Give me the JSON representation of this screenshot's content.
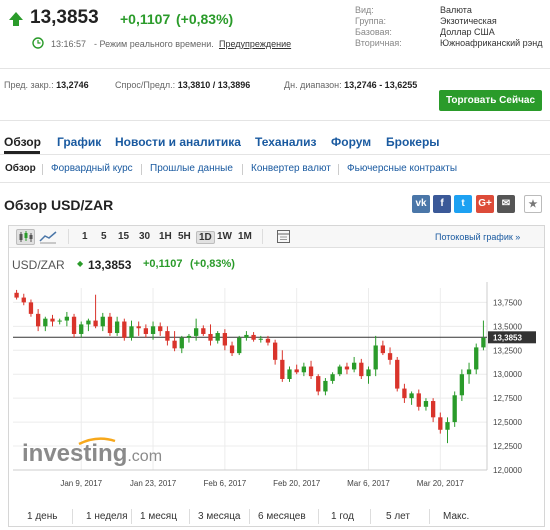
{
  "quote": {
    "price": "13,3853",
    "change": "+0,1107",
    "change_pct": "(+0,83%)",
    "time": "13:16:57",
    "realtime_text": "- Режим реального времени.",
    "warning_link": "Предупреждение",
    "up_color": "#2a9b2a",
    "down_color": "#d9342b"
  },
  "info": {
    "rows": [
      {
        "k": "Вид:",
        "v": "Валюта"
      },
      {
        "k": "Группа:",
        "v": "Экзотическая"
      },
      {
        "k": "Базовая:",
        "v": "Доллар США"
      },
      {
        "k": "Вторичная:",
        "v": "Южноафриканский рэнд"
      }
    ]
  },
  "stats": {
    "prev_close_label": "Пред. закр.:",
    "prev_close": "13,2746",
    "bid_ask_label": "Спрос/Предл.:",
    "bid_ask": "13,3810 / 13,3896",
    "day_range_label": "Дн. диапазон:",
    "day_range": "13,2746 - 13,6255"
  },
  "trade_button": "Торговать Сейчас",
  "nav": {
    "tabs": [
      "Обзор",
      "График",
      "Новости и аналитика",
      "Теханализ",
      "Форум",
      "Брокеры"
    ],
    "sub": [
      "Обзор",
      "Форвардный курс",
      "Прошлые данные",
      "Конвертер валют",
      "Фьючерсные контракты"
    ]
  },
  "section_title": "Обзор USD/ZAR",
  "share_icons": [
    {
      "name": "vk-icon",
      "glyph": "vk",
      "color": "#4a76a8"
    },
    {
      "name": "facebook-icon",
      "glyph": "f",
      "color": "#3b5998"
    },
    {
      "name": "twitter-icon",
      "glyph": "t",
      "color": "#1da1f2"
    },
    {
      "name": "google-plus-icon",
      "glyph": "G+",
      "color": "#dd4b39"
    },
    {
      "name": "email-icon",
      "glyph": "✉",
      "color": "#555555"
    },
    {
      "name": "bookmark-icon",
      "glyph": "★",
      "color": "#777777"
    }
  ],
  "toolbar": {
    "intervals": [
      "1",
      "5",
      "15",
      "30",
      "1H",
      "5H",
      "1D",
      "1W",
      "1M"
    ],
    "active_interval": "1D",
    "stream_link": "Потоковый график »"
  },
  "chart_header": {
    "symbol": "USD/ZAR",
    "arrow": "◆",
    "price": "13,3853",
    "change": "+0,1107",
    "change_pct": "(+0,83%)"
  },
  "logo": {
    "main": "investing",
    "suffix": ".com"
  },
  "ranges": [
    "1 день",
    "1 неделя",
    "1 месяц",
    "3 месяца",
    "6 месяцев",
    "1 год",
    "5 лет",
    "Макс."
  ],
  "chart_data": {
    "type": "candlestick",
    "ylim": [
      12.0,
      13.9
    ],
    "yticks": [
      "13,7500",
      "13,5000",
      "13,2500",
      "13,0000",
      "12,7500",
      "12,5000",
      "12,2500",
      "12,0000"
    ],
    "ytick_values": [
      13.75,
      13.5,
      13.25,
      13.0,
      12.75,
      12.5,
      12.25,
      12.0
    ],
    "xticks": [
      "Jan 9, 2017",
      "Jan 23, 2017",
      "Feb 6, 2017",
      "Feb 20, 2017",
      "Mar 6, 2017",
      "Mar 20, 2017"
    ],
    "xtick_index": [
      9,
      19,
      29,
      39,
      49,
      59
    ],
    "current_price_label": "13,3853",
    "current_price": 13.3853,
    "candles": [
      [
        13.85,
        13.88,
        13.78,
        13.8
      ],
      [
        13.8,
        13.84,
        13.72,
        13.75
      ],
      [
        13.75,
        13.78,
        13.6,
        13.63
      ],
      [
        13.63,
        13.68,
        13.45,
        13.5
      ],
      [
        13.5,
        13.6,
        13.45,
        13.58
      ],
      [
        13.58,
        13.62,
        13.5,
        13.55
      ],
      [
        13.55,
        13.58,
        13.52,
        13.56
      ],
      [
        13.56,
        13.65,
        13.5,
        13.6
      ],
      [
        13.6,
        13.63,
        13.38,
        13.42
      ],
      [
        13.42,
        13.55,
        13.38,
        13.52
      ],
      [
        13.52,
        13.58,
        13.45,
        13.56
      ],
      [
        13.56,
        13.83,
        13.48,
        13.5
      ],
      [
        13.5,
        13.64,
        13.45,
        13.6
      ],
      [
        13.6,
        13.64,
        13.4,
        13.43
      ],
      [
        13.43,
        13.6,
        13.4,
        13.55
      ],
      [
        13.55,
        13.58,
        13.35,
        13.38
      ],
      [
        13.38,
        13.56,
        13.35,
        13.5
      ],
      [
        13.5,
        13.55,
        13.4,
        13.48
      ],
      [
        13.48,
        13.52,
        13.38,
        13.42
      ],
      [
        13.42,
        13.55,
        13.36,
        13.5
      ],
      [
        13.5,
        13.54,
        13.4,
        13.45
      ],
      [
        13.45,
        13.5,
        13.3,
        13.35
      ],
      [
        13.35,
        13.45,
        13.24,
        13.27
      ],
      [
        13.27,
        13.4,
        13.22,
        13.38
      ],
      [
        13.38,
        13.42,
        13.33,
        13.4
      ],
      [
        13.4,
        13.58,
        13.35,
        13.48
      ],
      [
        13.48,
        13.51,
        13.4,
        13.42
      ],
      [
        13.42,
        13.52,
        13.3,
        13.35
      ],
      [
        13.35,
        13.45,
        13.32,
        13.43
      ],
      [
        13.43,
        13.47,
        13.25,
        13.3
      ],
      [
        13.3,
        13.34,
        13.19,
        13.22
      ],
      [
        13.22,
        13.4,
        13.2,
        13.38
      ],
      [
        13.38,
        13.45,
        13.35,
        13.41
      ],
      [
        13.41,
        13.44,
        13.34,
        13.36
      ],
      [
        13.36,
        13.4,
        13.33,
        13.37
      ],
      [
        13.37,
        13.4,
        13.3,
        13.33
      ],
      [
        13.33,
        13.36,
        13.1,
        13.15
      ],
      [
        13.15,
        13.25,
        12.92,
        12.95
      ],
      [
        12.95,
        13.08,
        12.92,
        13.05
      ],
      [
        13.05,
        13.1,
        13.0,
        13.02
      ],
      [
        13.02,
        13.12,
        12.98,
        13.08
      ],
      [
        13.08,
        13.14,
        12.95,
        12.98
      ],
      [
        12.98,
        13.0,
        12.78,
        12.82
      ],
      [
        12.82,
        12.96,
        12.78,
        12.93
      ],
      [
        12.93,
        13.02,
        12.9,
        13.0
      ],
      [
        13.0,
        13.1,
        12.98,
        13.08
      ],
      [
        13.08,
        13.12,
        13.0,
        13.05
      ],
      [
        13.05,
        13.18,
        13.02,
        13.12
      ],
      [
        13.12,
        13.16,
        12.95,
        12.98
      ],
      [
        12.98,
        13.08,
        12.9,
        13.05
      ],
      [
        13.05,
        13.4,
        12.98,
        13.3
      ],
      [
        13.3,
        13.35,
        13.2,
        13.22
      ],
      [
        13.22,
        13.28,
        13.1,
        13.15
      ],
      [
        13.15,
        13.18,
        12.82,
        12.85
      ],
      [
        12.85,
        12.9,
        12.7,
        12.75
      ],
      [
        12.75,
        12.82,
        12.68,
        12.8
      ],
      [
        12.8,
        12.84,
        12.62,
        12.66
      ],
      [
        12.66,
        12.75,
        12.62,
        12.72
      ],
      [
        12.72,
        12.75,
        12.5,
        12.55
      ],
      [
        12.55,
        12.6,
        12.38,
        12.42
      ],
      [
        12.42,
        12.55,
        12.28,
        12.5
      ],
      [
        12.5,
        12.82,
        12.45,
        12.78
      ],
      [
        12.78,
        13.05,
        12.72,
        13.0
      ],
      [
        13.0,
        13.12,
        12.9,
        13.05
      ],
      [
        13.05,
        13.32,
        13.0,
        13.28
      ],
      [
        13.28,
        13.56,
        13.25,
        13.38
      ]
    ]
  }
}
